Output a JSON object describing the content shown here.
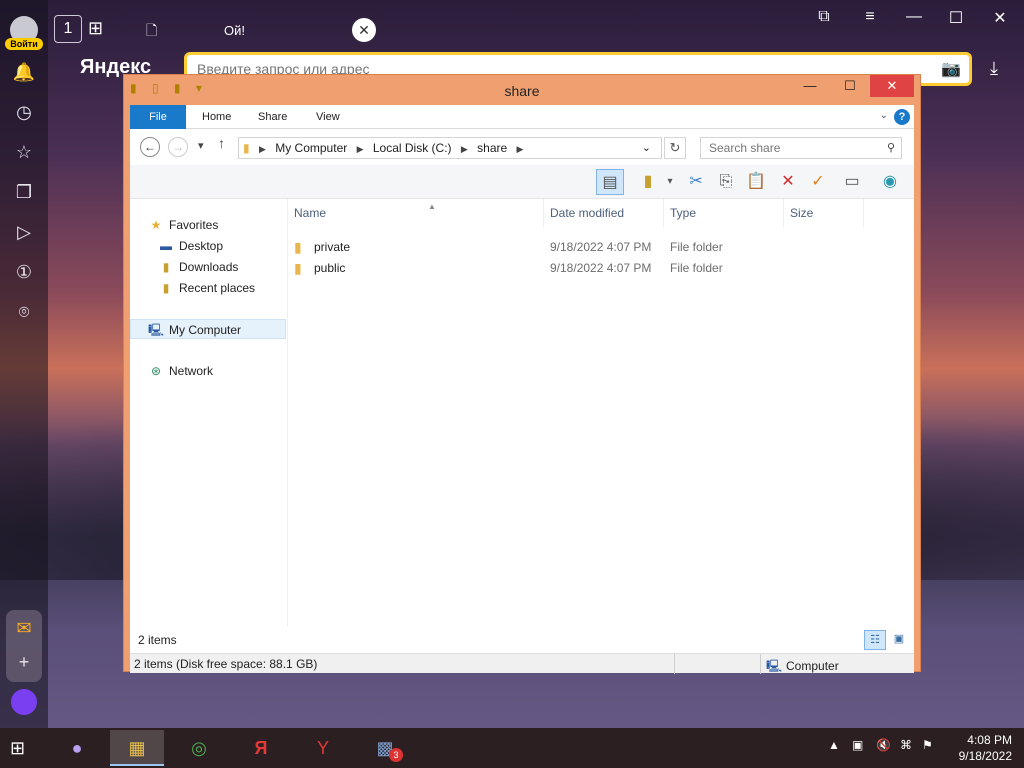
{
  "browser": {
    "login_label": "Войти",
    "tab_home_number": "1",
    "tab_title": "Ой!",
    "brand": "Яндекс",
    "omnibox_placeholder": "Введите запрос или адрес"
  },
  "explorer": {
    "title": "share",
    "ribbon_tabs": [
      "File",
      "Home",
      "Share",
      "View"
    ],
    "breadcrumb": [
      "My Computer",
      "Local Disk (C:)",
      "share"
    ],
    "search_placeholder": "Search share",
    "columns": [
      "Name",
      "Date modified",
      "Type",
      "Size"
    ],
    "nav": {
      "favorites": "Favorites",
      "desktop": "Desktop",
      "downloads": "Downloads",
      "recent": "Recent places",
      "computer": "My Computer",
      "network": "Network"
    },
    "files": [
      {
        "name": "private",
        "date": "9/18/2022 4:07 PM",
        "type": "File folder"
      },
      {
        "name": "public",
        "date": "9/18/2022 4:07 PM",
        "type": "File folder"
      }
    ],
    "item_count": "2 items",
    "status_left": "2 items (Disk free space: 88.1 GB)",
    "status_right": "Computer"
  },
  "taskbar": {
    "badge": "3",
    "time": "4:08 PM",
    "date": "9/18/2022"
  }
}
